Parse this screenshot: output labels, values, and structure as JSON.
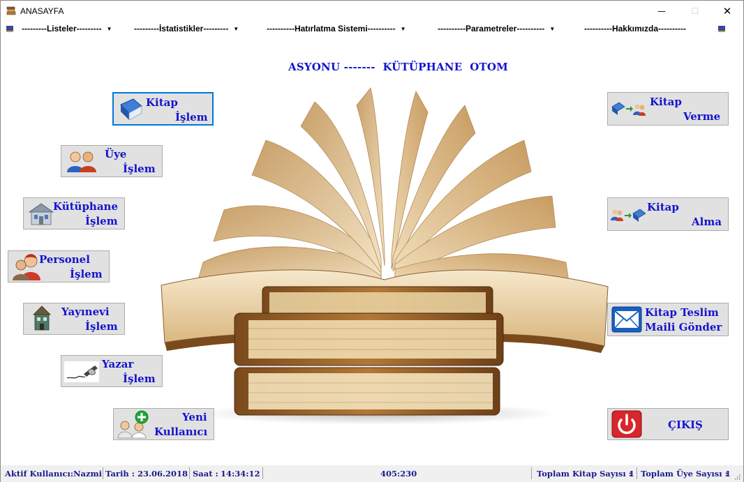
{
  "window": {
    "title": "ANASAYFA"
  },
  "menu": {
    "items": [
      {
        "label": "---------Listeler---------"
      },
      {
        "label": "---------İstatistikler---------"
      },
      {
        "label": "----------Hatırlatma Sistemi----------"
      },
      {
        "label": "----------Parametreler----------"
      },
      {
        "label": "----------Hakkımızda----------"
      }
    ]
  },
  "header": {
    "title": "ASYONU -------  KÜTÜPHANE  OTOM"
  },
  "buttons": {
    "kitap_islem": {
      "line1": "Kitap",
      "line2": "İşlem",
      "icon": "book-icon"
    },
    "uye_islem": {
      "line1": "Üye",
      "line2": "İşlem",
      "icon": "members-icon"
    },
    "kutuphane_islem": {
      "line1": "Kütüphane",
      "line2": "İşlem",
      "icon": "building-icon"
    },
    "personel_islem": {
      "line1": "Personel",
      "line2": "İşlem",
      "icon": "staff-icon"
    },
    "yayinevi_islem": {
      "line1": "Yayınevi",
      "line2": "İşlem",
      "icon": "publisher-house-icon"
    },
    "yazar_islem": {
      "line1": "Yazar",
      "line2": "İşlem",
      "icon": "writing-hand-icon"
    },
    "yeni_kullanici": {
      "line1": "Yeni",
      "line2": "Kullanıcı",
      "icon": "add-user-icon"
    },
    "kitap_verme": {
      "line1": "Kitap",
      "line2": "Verme",
      "icon": "book-to-users-icon"
    },
    "kitap_alma": {
      "line1": "Kitap",
      "line2": "Alma",
      "icon": "users-to-book-icon"
    },
    "kitap_teslim_mail": {
      "line1": "Kitap Teslim",
      "line2": "Maili Gönder",
      "icon": "envelope-icon"
    },
    "cikis": {
      "label": "ÇIKIŞ",
      "icon": "power-icon"
    }
  },
  "status": {
    "user_label": "Aktif Kullanıcı:",
    "user_value": "Nazmi",
    "date_label": "Tarih :",
    "date_value": "23.06.2018",
    "time_label": "Saat :",
    "time_value": "14:34:12",
    "coords": "405:230",
    "book_count_label": "Toplam Kitap Sayısı :",
    "book_count_value": "1",
    "member_count_label": "Toplam Üye Sayısı :",
    "member_count_value": "1"
  },
  "colors": {
    "button_text": "#1414ce",
    "button_bg": "#e1e1e1",
    "focus_border": "#0078d7",
    "status_text": "#1a1a8c"
  }
}
